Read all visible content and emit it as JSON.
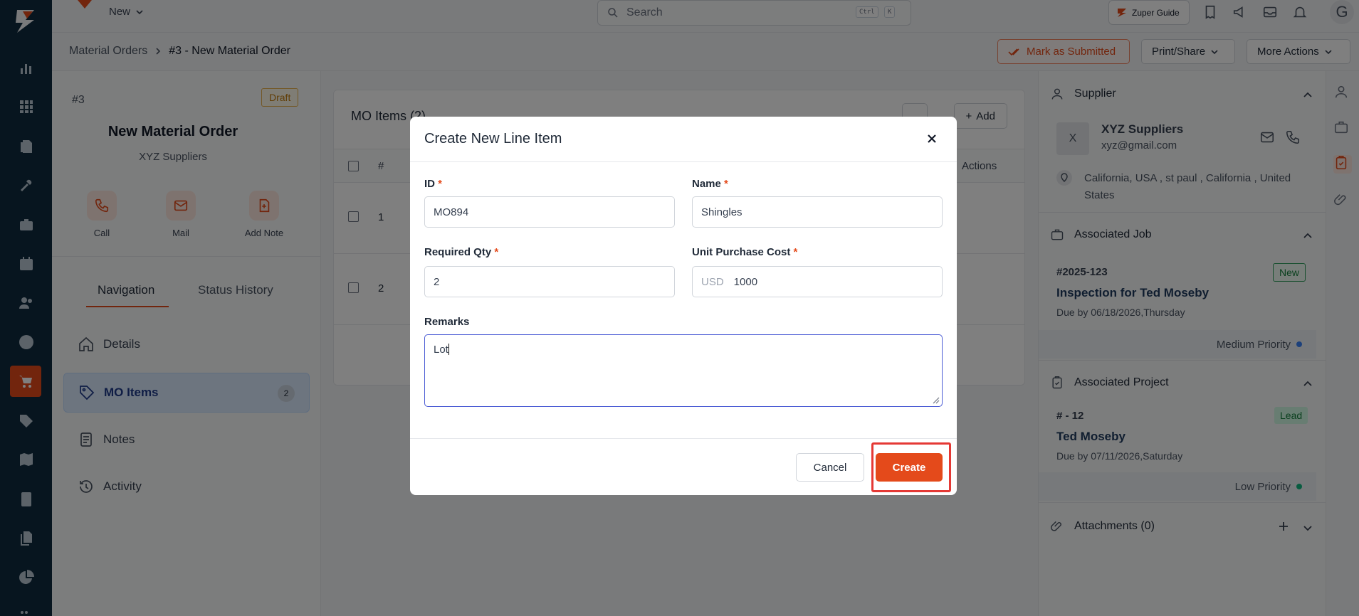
{
  "topbar": {
    "new_label": "New",
    "search_placeholder": "Search",
    "kbd_ctrl": "Ctrl",
    "kbd_k": "K",
    "guide_label": "Zuper Guide",
    "avatar_initial": "G"
  },
  "breadcrumb": {
    "root": "Material Orders",
    "current": "#3 - New Material Order"
  },
  "actions": {
    "mark_submitted": "Mark as Submitted",
    "print_share": "Print/Share",
    "more_actions": "More Actions"
  },
  "order": {
    "number": "#3",
    "status": "Draft",
    "title": "New Material Order",
    "supplier": "XYZ Suppliers"
  },
  "quick_actions": [
    "Call",
    "Mail",
    "Add Note"
  ],
  "left_tabs": [
    "Navigation",
    "Status History"
  ],
  "nav": {
    "details": "Details",
    "mo_items": "MO Items",
    "mo_items_count": "2",
    "notes": "Notes",
    "activity": "Activity"
  },
  "mo_items": {
    "title": "MO Items (2)",
    "add_label": "Add",
    "col_num": "#",
    "col_actions": "Actions",
    "rows": [
      "1",
      "2"
    ]
  },
  "supplier_panel": {
    "header": "Supplier",
    "avatar": "X",
    "name": "XYZ Suppliers",
    "email": "xyz@gmail.com",
    "address_line1": "California, USA , st paul , California , United",
    "address_line2": "States"
  },
  "job_panel": {
    "header": "Associated Job",
    "number": "#2025-123",
    "badge": "New",
    "title": "Inspection for Ted Moseby",
    "due": "Due by 06/18/2026,Thursday",
    "priority": "Medium Priority",
    "priority_color": "#3b82f6"
  },
  "project_panel": {
    "header": "Associated Project",
    "number": "# - 12",
    "badge": "Lead",
    "title": "Ted Moseby",
    "due": "Due by 07/11/2026,Saturday",
    "priority": "Low Priority",
    "priority_color": "#10b981"
  },
  "attachments": {
    "header": "Attachments (0)"
  },
  "modal": {
    "title": "Create New Line Item",
    "id_label": "ID",
    "id_value": "MO894",
    "name_label": "Name",
    "name_value": "Shingles",
    "qty_label": "Required Qty",
    "qty_value": "2",
    "cost_label": "Unit Purchase Cost",
    "cost_currency": "USD",
    "cost_value": "1000",
    "remarks_label": "Remarks",
    "remarks_value": "Lot",
    "required_mark": "*",
    "cancel_label": "Cancel",
    "create_label": "Create"
  },
  "colors": {
    "accent": "#e44a1b",
    "rail": "#0f2a3f"
  }
}
